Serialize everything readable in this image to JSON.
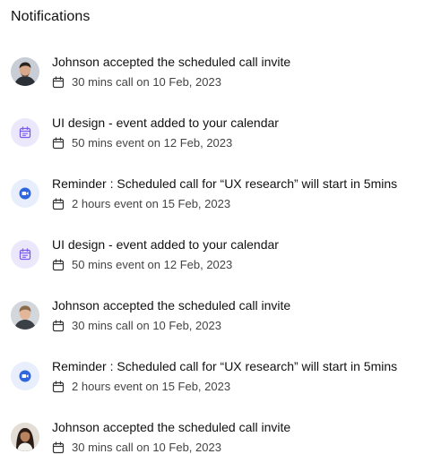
{
  "header": {
    "title": "Notifications"
  },
  "notifications": [
    {
      "type": "person",
      "avatar": "avatar-man-dark-hair",
      "title": "Johnson accepted the scheduled call invite",
      "meta": "30 mins call on 10 Feb, 2023"
    },
    {
      "type": "calendar",
      "avatar": "calendar-icon",
      "title": "UI design - event added to your calendar",
      "meta": "50 mins event on 12 Feb, 2023"
    },
    {
      "type": "video",
      "avatar": "video-camera-icon",
      "title": "Reminder : Scheduled call for “UX research” will start in 5mins",
      "meta": "2 hours event on 15 Feb, 2023"
    },
    {
      "type": "calendar",
      "avatar": "calendar-icon",
      "title": "UI design - event added to your calendar",
      "meta": "50 mins event on 12 Feb, 2023"
    },
    {
      "type": "person",
      "avatar": "avatar-man-light-hair",
      "title": "Johnson accepted the scheduled call invite",
      "meta": "30 mins call on 10 Feb, 2023"
    },
    {
      "type": "video",
      "avatar": "video-camera-icon",
      "title": "Reminder : Scheduled call for “UX research” will start in 5mins",
      "meta": "2 hours event on 15 Feb, 2023"
    },
    {
      "type": "person",
      "avatar": "avatar-woman-dark-hair",
      "title": "Johnson accepted the scheduled call invite",
      "meta": "30 mins call on 10 Feb, 2023"
    }
  ],
  "colors": {
    "calendar_accent": "#7b5cf0",
    "calendar_bg": "#ece8fb",
    "video_accent": "#2f66e0",
    "video_bg": "#e8eefb",
    "text_primary": "#111111",
    "text_secondary": "#444444"
  }
}
